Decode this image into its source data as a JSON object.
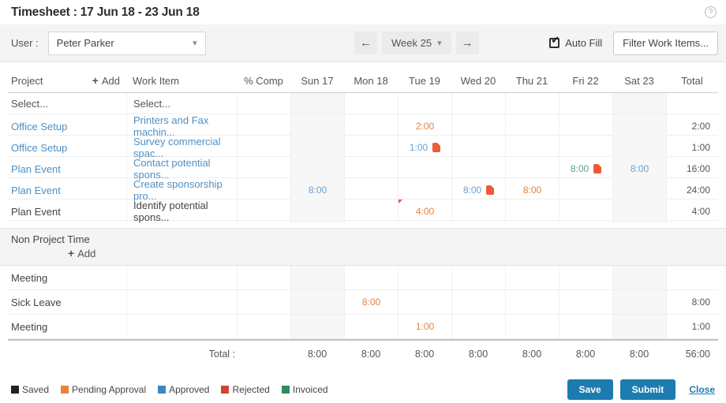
{
  "header": {
    "title": "Timesheet : 17 Jun 18 - 23 Jun 18",
    "help_icon": "?"
  },
  "toolbar": {
    "user_label": "User :",
    "user_value": "Peter Parker",
    "prev_week_icon": "←",
    "next_week_icon": "→",
    "week_label": "Week 25",
    "autofill_label": "Auto Fill",
    "filter_button_label": "Filter Work Items..."
  },
  "table": {
    "columns": {
      "project": "Project",
      "add_label": "Add",
      "work_item": "Work Item",
      "percent_complete": "% Comp",
      "days": [
        "Sun 17",
        "Mon 18",
        "Tue 19",
        "Wed 20",
        "Thu 21",
        "Fri 22",
        "Sat 23"
      ],
      "total": "Total"
    },
    "rows": [
      {
        "project": "Select...",
        "work_item": "Select...",
        "style": "placeholder",
        "cells": [
          null,
          null,
          null,
          null,
          null,
          null,
          null
        ],
        "total": ""
      },
      {
        "project": "Office Setup",
        "work_item": "Printers and Fax machin...",
        "style": "link",
        "cells": [
          null,
          null,
          {
            "value": "2:00",
            "status": "pending"
          },
          null,
          null,
          null,
          null
        ],
        "total": "2:00"
      },
      {
        "project": "Office Setup",
        "work_item": "Survey commercial spac...",
        "style": "link",
        "cells": [
          null,
          null,
          {
            "value": "1:00",
            "status": "approved",
            "doc_icon": true
          },
          null,
          null,
          null,
          null
        ],
        "total": "1:00"
      },
      {
        "project": "Plan Event",
        "work_item": "Contact potential spons...",
        "style": "link",
        "cells": [
          null,
          null,
          null,
          null,
          null,
          {
            "value": "8:00",
            "status": "invoiced",
            "doc_icon": true
          },
          {
            "value": "8:00",
            "status": "approved"
          }
        ],
        "total": "16:00"
      },
      {
        "project": "Plan Event",
        "work_item": "Create sponsorship pro...",
        "style": "link",
        "cells": [
          {
            "value": "8:00",
            "status": "approved"
          },
          null,
          null,
          {
            "value": "8:00",
            "status": "approved",
            "doc_icon": true
          },
          {
            "value": "8:00",
            "status": "pending"
          },
          null,
          null
        ],
        "total": "24:00"
      },
      {
        "project": "Plan Event",
        "work_item": "Identify potential spons...",
        "style": "plain",
        "cells": [
          null,
          null,
          {
            "value": "4:00",
            "status": "pending",
            "note_flag": true
          },
          null,
          null,
          null,
          null
        ],
        "total": "4:00"
      }
    ]
  },
  "non_project": {
    "title": "Non Project Time",
    "add_label": "Add",
    "rows": [
      {
        "name": "Meeting",
        "cells": [
          null,
          null,
          null,
          null,
          null,
          null,
          null
        ],
        "total": ""
      },
      {
        "name": "Sick Leave",
        "cells": [
          null,
          {
            "value": "8:00",
            "status": "pending"
          },
          null,
          null,
          null,
          null,
          null
        ],
        "total": "8:00"
      },
      {
        "name": "Meeting",
        "cells": [
          null,
          null,
          {
            "value": "1:00",
            "status": "pending"
          },
          null,
          null,
          null,
          null
        ],
        "total": "1:00"
      }
    ]
  },
  "totals": {
    "label": "Total :",
    "day_totals": [
      "8:00",
      "8:00",
      "8:00",
      "8:00",
      "8:00",
      "8:00",
      "8:00"
    ],
    "grand_total": "56:00"
  },
  "legend": [
    {
      "label": "Saved",
      "color": "#222222"
    },
    {
      "label": "Pending Approval",
      "color": "#e8823e"
    },
    {
      "label": "Approved",
      "color": "#3c85c4"
    },
    {
      "label": "Rejected",
      "color": "#d0452e"
    },
    {
      "label": "Invoiced",
      "color": "#35885b"
    }
  ],
  "footer": {
    "save_label": "Save",
    "submit_label": "Submit",
    "close_label": "Close"
  },
  "status_colors": {
    "pending": "#e8823e",
    "approved": "#68a3d8",
    "invoiced": "#58a87e"
  }
}
